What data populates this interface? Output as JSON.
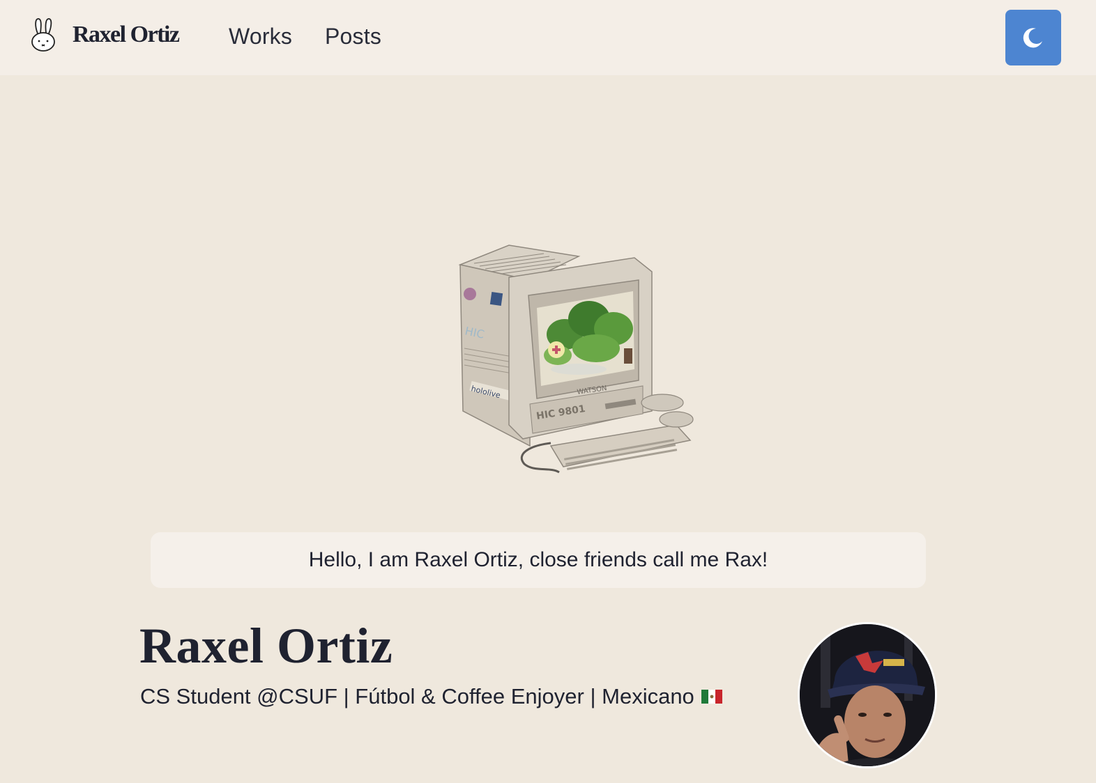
{
  "header": {
    "brand_name": "Raxel Ortiz",
    "logo_icon": "bunny-icon",
    "nav": [
      {
        "label": "Works"
      },
      {
        "label": "Posts"
      }
    ],
    "theme_toggle_icon": "moon-icon"
  },
  "hero": {
    "illustration": "retro-computer-illustration",
    "greeting": "Hello, I am Raxel Ortiz, close friends call me Rax!"
  },
  "profile": {
    "name": "Raxel Ortiz",
    "tagline": "CS Student @CSUF | Fútbol & Coffee Enjoyer | Mexicano",
    "flag_icon": "mexico-flag-icon",
    "avatar": "profile-photo"
  },
  "colors": {
    "page_bg": "#efe8dd",
    "header_bg": "#f4eee7",
    "accent": "#4d85d1",
    "text": "#1f2230"
  }
}
